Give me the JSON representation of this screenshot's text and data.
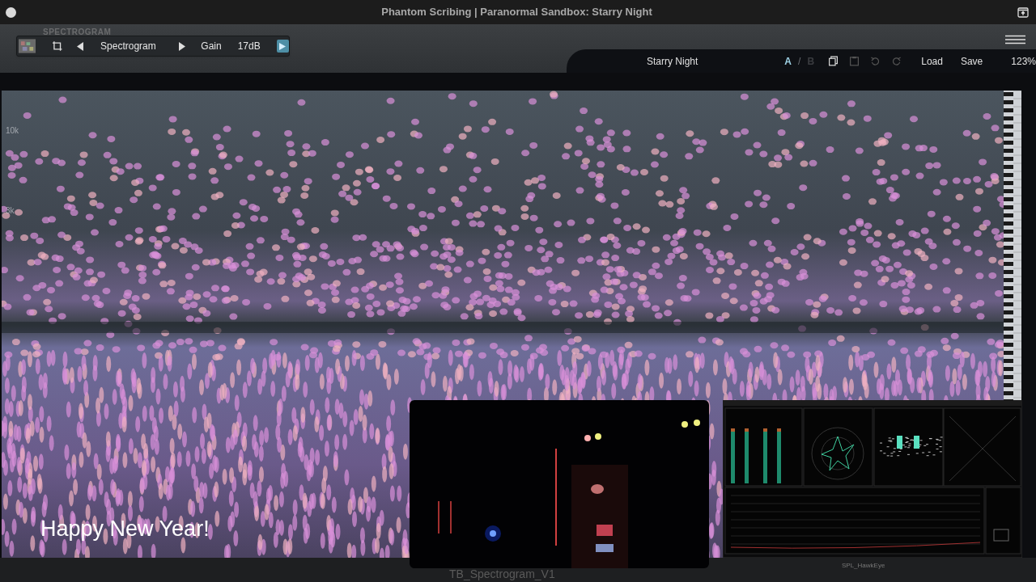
{
  "window": {
    "title": "Phantom Scribing | Paranormal Sandbox: Starry Night"
  },
  "toolbar": {
    "plugin_name": "SPECTROGRAM",
    "view": "Spectrogram",
    "gain_label": "Gain",
    "gain_value": "17dB"
  },
  "preset_bar": {
    "preset": "Starry Night",
    "ab": [
      {
        "label": "A",
        "selected": true
      },
      {
        "label": "B",
        "selected": false
      }
    ],
    "separator": "/",
    "buttons": [
      "Load",
      "Save"
    ],
    "zoom": "123%"
  },
  "spectrogram": {
    "axis_labels": [
      "10k",
      "3k"
    ]
  },
  "overlay_text": "Happy New Year!",
  "video": {
    "kind": "picture",
    "caption": "TB_Spectrogram_V1"
  },
  "analyzer": {
    "caption": "SPL_HawkEye"
  }
}
